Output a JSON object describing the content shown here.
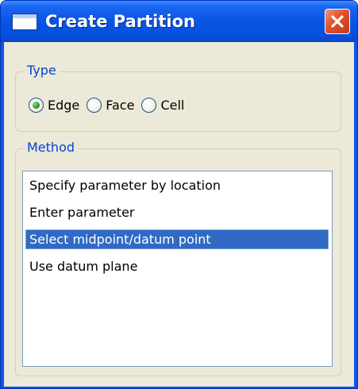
{
  "window": {
    "title": "Create Partition"
  },
  "type_group": {
    "legend": "Type",
    "options": [
      {
        "label": "Edge",
        "checked": true
      },
      {
        "label": "Face",
        "checked": false
      },
      {
        "label": "Cell",
        "checked": false
      }
    ]
  },
  "method_group": {
    "legend": "Method",
    "items": [
      "Specify parameter by location",
      "Enter parameter",
      "Select midpoint/datum point",
      "Use datum plane"
    ],
    "selected_item": "Select midpoint/datum point"
  },
  "colors": {
    "titlebar": "#0a54e4",
    "selection": "#316ac5",
    "legend_text": "#0046d5",
    "client_bg": "#ece9d8",
    "close_button": "#e2502a"
  },
  "icons": {
    "system": "window-icon",
    "close": "close-icon",
    "radio_checked": "radio-checked-icon",
    "radio_unchecked": "radio-unchecked-icon"
  }
}
